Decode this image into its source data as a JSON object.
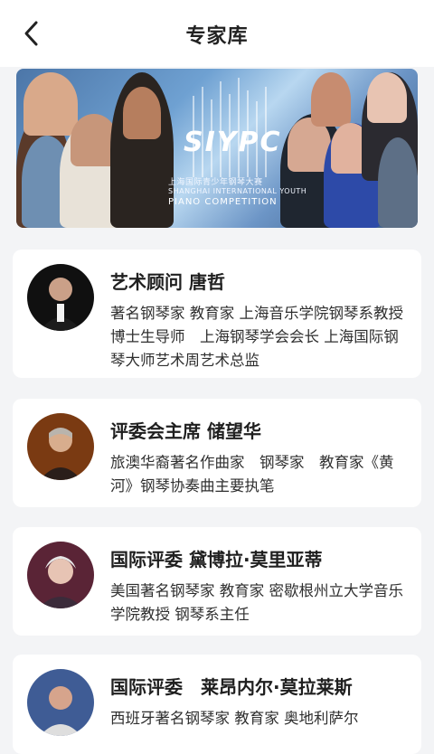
{
  "header": {
    "title": "专家库",
    "back_icon": "chevron-left-icon"
  },
  "banner": {
    "logo": "SIYPC",
    "subtitle_cn": "上海国际青少年钢琴大赛",
    "subtitle_en": "SHANGHAI INTERNATIONAL YOUTH",
    "subtitle_en2": "PIANO COMPETITION"
  },
  "experts": [
    {
      "name": "艺术顾问 唐哲",
      "desc": "著名钢琴家 教育家 上海音乐学院钢琴系教授 博士生导师　上海钢琴学会会长 上海国际钢琴大师艺术周艺术总监"
    },
    {
      "name": "评委会主席 储望华",
      "desc": "旅澳华裔著名作曲家　钢琴家　教育家《黄河》钢琴协奏曲主要执笔"
    },
    {
      "name": "国际评委 黛博拉·莫里亚蒂",
      "desc": "美国著名钢琴家 教育家 密歇根州立大学音乐学院教授 钢琴系主任"
    },
    {
      "name": "国际评委　莱昂内尔·莫拉莱斯",
      "desc": "西班牙著名钢琴家 教育家 奥地利萨尔"
    }
  ]
}
